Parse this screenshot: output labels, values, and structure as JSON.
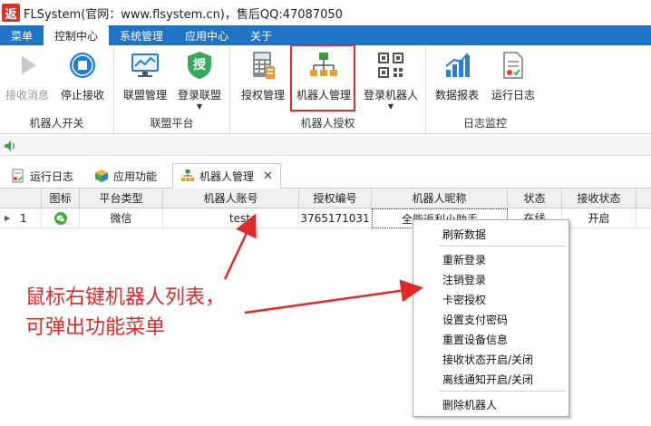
{
  "window": {
    "title": "FLSystem(官网：www.flsystem.cn)，售后QQ:47087050",
    "logo_text": "返"
  },
  "menubar": {
    "items": [
      "菜单",
      "控制中心",
      "系统管理",
      "应用中心",
      "关于"
    ],
    "active": "控制中心"
  },
  "ribbon": {
    "groups": [
      {
        "label": "机器人开关",
        "buttons": [
          {
            "label": "接收消息",
            "icon": "play-icon",
            "disabled": true
          },
          {
            "label": "停止接收",
            "icon": "stop-icon"
          }
        ]
      },
      {
        "label": "联盟平台",
        "buttons": [
          {
            "label": "联盟管理",
            "icon": "chart-monitor-icon"
          },
          {
            "label": "登录联盟",
            "icon": "shield-icon",
            "icon_text": "授",
            "dropdown": true
          }
        ]
      },
      {
        "label": "机器人授权",
        "buttons": [
          {
            "label": "授权管理",
            "icon": "calculator-icon"
          },
          {
            "label": "机器人管理",
            "icon": "network-icon",
            "highlighted": true
          },
          {
            "label": "登录机器人",
            "icon": "qrcode-icon",
            "dropdown": true
          }
        ]
      },
      {
        "label": "日志监控",
        "buttons": [
          {
            "label": "数据报表",
            "icon": "bar-chart-icon"
          },
          {
            "label": "运行日志",
            "icon": "log-document-icon"
          }
        ]
      }
    ]
  },
  "tabs": [
    {
      "label": "运行日志",
      "icon": "log-icon"
    },
    {
      "label": "应用功能",
      "icon": "cube-icon"
    },
    {
      "label": "机器人管理",
      "icon": "network-icon",
      "active": true
    }
  ],
  "table": {
    "columns": [
      "图标",
      "平台类型",
      "机器人账号",
      "授权编号",
      "机器人昵称",
      "状态",
      "接收状态"
    ],
    "rows": [
      {
        "index": "1",
        "icon": "wechat-icon",
        "platform": "微信",
        "account": "test",
        "auth_code": "3765171031",
        "nickname": "全能返利小助手",
        "status": "在线",
        "receive": "开启"
      }
    ]
  },
  "context_menu": {
    "items": [
      "刷新数据",
      "重新登录",
      "注销登录",
      "卡密授权",
      "设置支付密码",
      "重置设备信息",
      "接收状态开启/关闭",
      "离线通知开启/关闭",
      "删除机器人"
    ]
  },
  "annotation": {
    "line1": "鼠标右键机器人列表，",
    "line2": "可弹出功能菜单"
  },
  "colors": {
    "menubar": "#1e73c5",
    "highlight": "#e02a2a",
    "annotation": "#e02a2a",
    "wechat": "#3cb034"
  }
}
